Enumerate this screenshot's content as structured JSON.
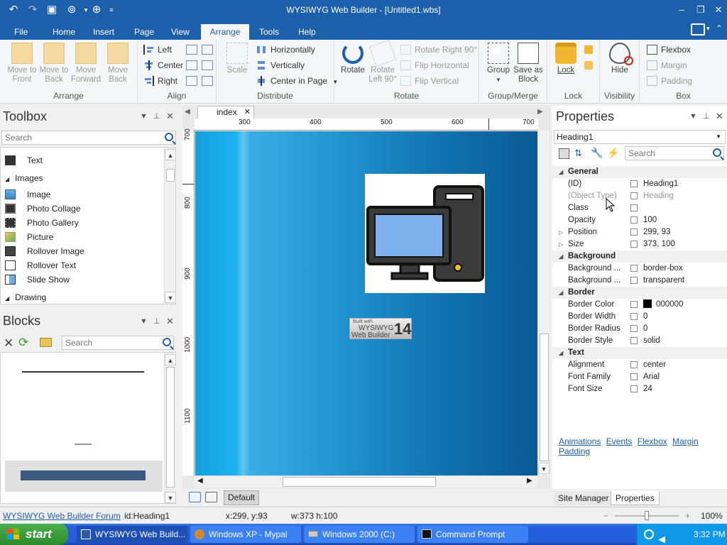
{
  "window": {
    "title": "WYSIWYG Web Builder - [Untitled1.wbs]"
  },
  "menu": {
    "tabs": [
      "File",
      "Home",
      "Insert",
      "Page",
      "View",
      "Arrange",
      "Tools",
      "Help"
    ],
    "active": "Arrange"
  },
  "ribbon": {
    "arrange": {
      "label": "Arrange",
      "buttons": [
        "Move to Front",
        "Move to Back",
        "Move Forward",
        "Move Back"
      ]
    },
    "align": {
      "label": "Align",
      "buttons": [
        "Left",
        "Center",
        "Right"
      ]
    },
    "distribute": {
      "label": "Distribute",
      "scale": "Scale",
      "buttons": [
        "Horizontally",
        "Vertically",
        "Center in Page"
      ]
    },
    "rotate": {
      "label": "Rotate",
      "rotate": "Rotate",
      "rotate_left": "Rotate Left 90°",
      "buttons": [
        "Rotate Right 90°",
        "Flip Horizontal",
        "Flip Vertical"
      ]
    },
    "group_merge": {
      "label": "Group/Merge",
      "group": "Group",
      "save_as_block": "Save as Block"
    },
    "lock": {
      "label": "Lock",
      "lock": "Lock"
    },
    "visibility": {
      "label": "Visibility",
      "hide": "Hide"
    },
    "box": {
      "label": "Box",
      "buttons": [
        "Flexbox",
        "Margin",
        "Padding"
      ]
    }
  },
  "toolbox": {
    "title": "Toolbox",
    "search_placeholder": "Search",
    "items": [
      {
        "label": "Text",
        "type": "item"
      },
      {
        "label": "Images",
        "type": "category"
      },
      {
        "label": "Image",
        "type": "item"
      },
      {
        "label": "Photo Collage",
        "type": "item"
      },
      {
        "label": "Photo Gallery",
        "type": "item"
      },
      {
        "label": "Picture",
        "type": "item"
      },
      {
        "label": "Rollover Image",
        "type": "item"
      },
      {
        "label": "Rollover Text",
        "type": "item"
      },
      {
        "label": "Slide Show",
        "type": "item"
      },
      {
        "label": "Drawing",
        "type": "category"
      }
    ]
  },
  "blocks": {
    "title": "Blocks",
    "search_placeholder": "Search"
  },
  "editor": {
    "tab": "index",
    "ruler_h": [
      "300",
      "400",
      "500",
      "600",
      "700"
    ],
    "ruler_v": [
      "700",
      "800",
      "900",
      "1000",
      "1100"
    ],
    "badge_line1": "Built with",
    "badge_line2": "WYSIWYG",
    "badge_line3": "Web Builder",
    "badge_num": "14",
    "bottom_tab": "Default"
  },
  "properties": {
    "title": "Properties",
    "selected_object": "Heading1",
    "search_placeholder": "Search",
    "rows": [
      {
        "name": "General",
        "cat": true
      },
      {
        "name": "(ID)",
        "value": "Heading1"
      },
      {
        "name": "(Object Type)",
        "value": "Heading",
        "dim": true
      },
      {
        "name": "Class",
        "value": ""
      },
      {
        "name": "Opacity",
        "value": "100"
      },
      {
        "name": "Position",
        "value": "299, 93",
        "exp": true
      },
      {
        "name": "Size",
        "value": "373, 100",
        "exp": true
      },
      {
        "name": "Background",
        "cat": true
      },
      {
        "name": "Background ...",
        "value": "border-box"
      },
      {
        "name": "Background ...",
        "value": "transparent"
      },
      {
        "name": "Border",
        "cat": true
      },
      {
        "name": "Border Color",
        "value": "000000",
        "swatch": "#000000"
      },
      {
        "name": "Border Width",
        "value": "0"
      },
      {
        "name": "Border Radius",
        "value": "0"
      },
      {
        "name": "Border Style",
        "value": "solid"
      },
      {
        "name": "Text",
        "cat": true
      },
      {
        "name": "Alignment",
        "value": "center"
      },
      {
        "name": "Font Family",
        "value": "Arial"
      },
      {
        "name": "Font Size",
        "value": "24"
      }
    ],
    "links": [
      "Animations",
      "Events",
      "Flexbox",
      "Margin",
      "Padding"
    ],
    "bottom_tabs": [
      "Site Manager",
      "Properties"
    ]
  },
  "statusbar": {
    "forum_link": "WYSIWYG Web Builder Forum",
    "id": "id:Heading1",
    "pos": "x:299, y:93",
    "size": "w:373 h:100",
    "zoom": "100%"
  },
  "taskbar": {
    "start": "start",
    "items": [
      "WYSIWYG Web Build...",
      "Windows XP - Mypal",
      "Windows 2000 (C:)",
      "Command Prompt"
    ],
    "clock": "3:32 PM"
  },
  "colors": {
    "accent": "#1c5faa",
    "canvas_gradient_start": "#13a0e0",
    "canvas_gradient_end": "#0a5a96"
  }
}
